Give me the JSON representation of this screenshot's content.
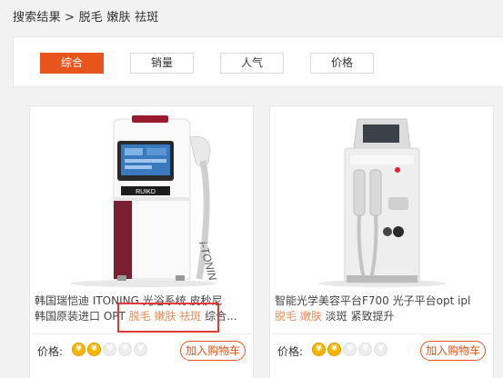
{
  "breadcrumb": {
    "prefix": "搜索结果",
    "separator": ">",
    "query": "脱毛 嫩肤 祛斑"
  },
  "sort": {
    "active_color": "#e8551c",
    "buttons": [
      {
        "label": "综合",
        "active": true
      },
      {
        "label": "销量",
        "active": false
      },
      {
        "label": "人气",
        "active": false
      },
      {
        "label": "价格",
        "active": false
      }
    ]
  },
  "products": [
    {
      "title_plain_1": "韩国瑞恺迪 ITONING 光浴系统 皮秒尼",
      "title_plain_2": "韩国原装进口 OPT ",
      "title_hl": "脱毛 嫩肤 祛斑",
      "title_tail": " 综合...",
      "image_brand": "RUIKD",
      "image_side_text": "i-TONIN",
      "price_label": "价格:",
      "price_level": 2,
      "price_level_max": 5,
      "cart_label": "加入购物车"
    },
    {
      "title_plain_1": "智能光学美容平台F700 光子平台opt ipl",
      "title_hl": "脱毛 嫩肤",
      "title_tail": " 淡斑 紧致提升",
      "price_label": "价格:",
      "price_level": 2,
      "price_level_max": 5,
      "cart_label": "加入购物车"
    }
  ],
  "icons": {
    "coin": "yen-coin-icon"
  }
}
